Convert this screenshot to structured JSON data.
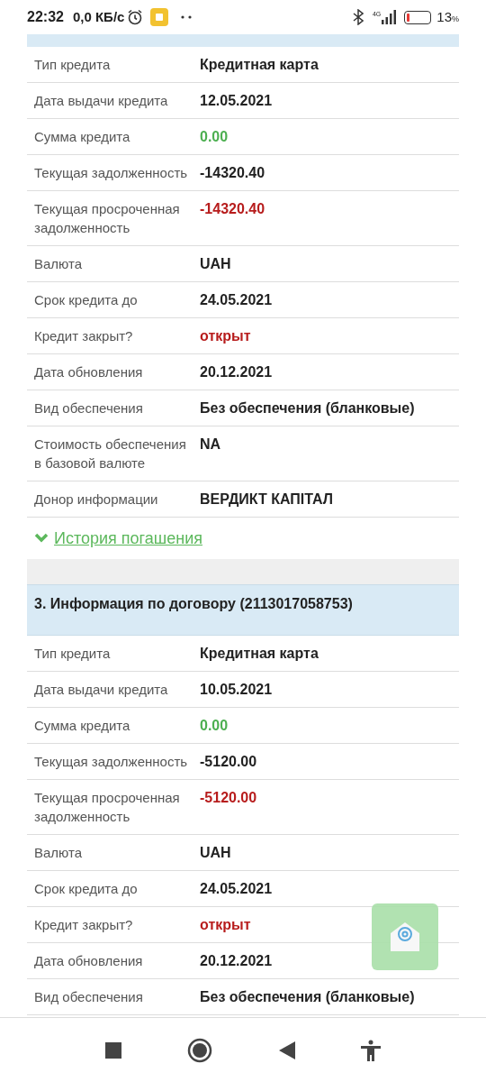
{
  "status_bar": {
    "time": "22:32",
    "speed": "0,0 КБ/с",
    "network": "4G",
    "battery": {
      "level": 0.13,
      "percent": "13",
      "unit": "%"
    }
  },
  "sections": [
    {
      "rows": [
        {
          "label": "Тип кредита",
          "value": "Кредитная карта",
          "kind": "text"
        },
        {
          "label": "Дата выдачи кредита",
          "value": "12.05.2021",
          "kind": "text"
        },
        {
          "label": "Сумма кредита",
          "value": "0.00",
          "kind": "positive"
        },
        {
          "label": "Текущая задолженность",
          "value": "-14320.40",
          "kind": "text"
        },
        {
          "label": "Текущая просроченная задолженность",
          "value": "-14320.40",
          "kind": "negative"
        },
        {
          "label": "Валюта",
          "value": "UAH",
          "kind": "text"
        },
        {
          "label": "Срок кредита до",
          "value": "24.05.2021",
          "kind": "text"
        },
        {
          "label": "Кредит закрыт?",
          "value": "открыт",
          "kind": "negative"
        },
        {
          "label": "Дата обновления",
          "value": "20.12.2021",
          "kind": "text"
        },
        {
          "label": "Вид обеспечения",
          "value": "Без обеспечения (бланковые)",
          "kind": "text"
        },
        {
          "label": "Стоимость обеспечения в базовой валюте",
          "value": "NA",
          "kind": "text"
        },
        {
          "label": "Донор информации",
          "value": "ВЕРДИКТ КАПІТАЛ",
          "kind": "text"
        }
      ],
      "history_link": "История погашения"
    },
    {
      "title": "3. Информация по договору (2113017058753)",
      "rows": [
        {
          "label": "Тип кредита",
          "value": "Кредитная карта",
          "kind": "text"
        },
        {
          "label": "Дата выдачи кредита",
          "value": "10.05.2021",
          "kind": "text"
        },
        {
          "label": "Сумма кредита",
          "value": "0.00",
          "kind": "positive"
        },
        {
          "label": "Текущая задолженность",
          "value": "-5120.00",
          "kind": "text"
        },
        {
          "label": "Текущая просроченная задолженность",
          "value": "-5120.00",
          "kind": "negative"
        },
        {
          "label": "Валюта",
          "value": "UAH",
          "kind": "text"
        },
        {
          "label": "Срок кредита до",
          "value": "24.05.2021",
          "kind": "text"
        },
        {
          "label": "Кредит закрыт?",
          "value": "открыт",
          "kind": "negative"
        },
        {
          "label": "Дата обновления",
          "value": "20.12.2021",
          "kind": "text"
        },
        {
          "label": "Вид обеспечения",
          "value": "Без обеспечения (бланковые)",
          "kind": "text"
        }
      ]
    }
  ]
}
